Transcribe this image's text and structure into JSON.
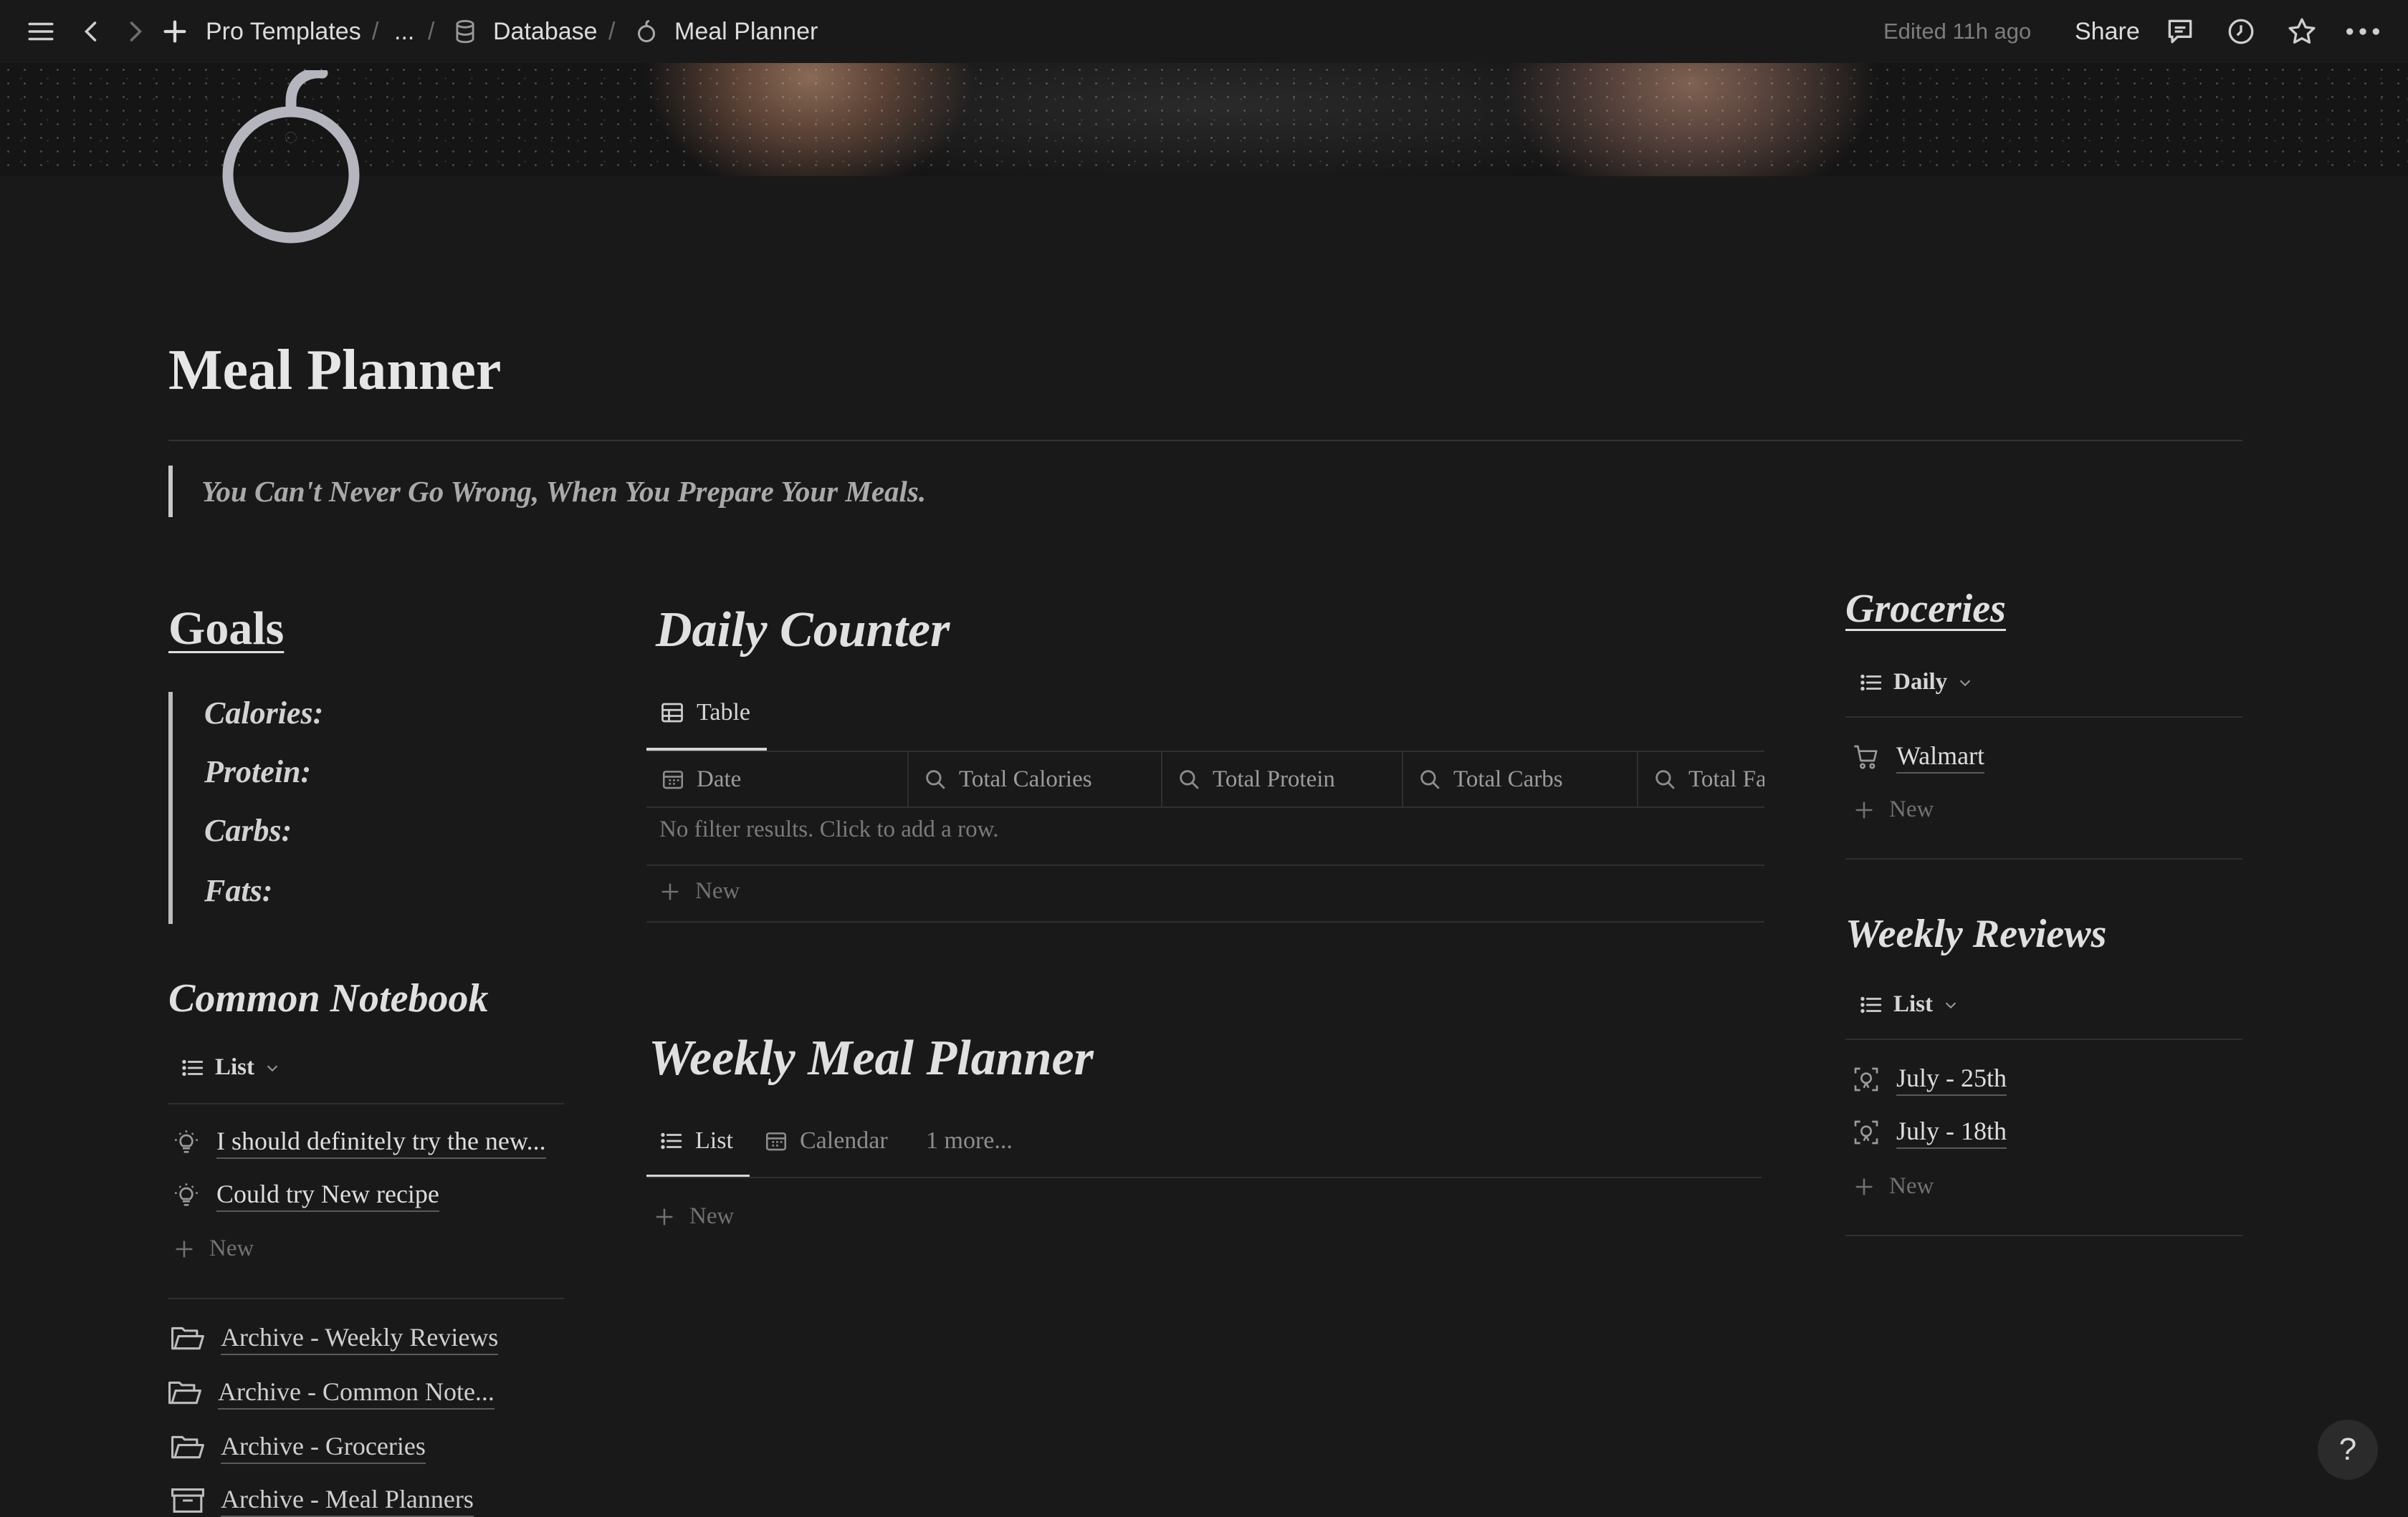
{
  "topbar": {
    "breadcrumbs": [
      "Pro Templates",
      "...",
      "Database",
      "Meal Planner"
    ],
    "edited": "Edited 11h ago",
    "share_label": "Share"
  },
  "page": {
    "title": "Meal Planner",
    "quote": "You Can't Never Go Wrong, When You Prepare Your Meals."
  },
  "goals": {
    "heading": "Goals",
    "items": [
      "Calories:",
      "Protein:",
      "Carbs:",
      "Fats:"
    ]
  },
  "common_notebook": {
    "heading": "Common Notebook",
    "view": "List",
    "items": [
      "I should definitely try the new...",
      "Could try New recipe"
    ],
    "new_label": "New"
  },
  "archives": [
    "Archive - Weekly Reviews",
    "Archive - Common Note...",
    "Archive - Groceries",
    "Archive - Meal Planners"
  ],
  "daily_counter": {
    "heading": "Daily Counter",
    "tab": "Table",
    "columns": [
      "Date",
      "Total Calories",
      "Total Protein",
      "Total Carbs",
      "Total Fats"
    ],
    "empty_message": "No filter results. Click to add a row.",
    "new_label": "New"
  },
  "weekly_meal_planner": {
    "heading": "Weekly Meal Planner",
    "tabs": [
      "List",
      "Calendar",
      "1 more..."
    ],
    "new_label": "New"
  },
  "groceries": {
    "heading": "Groceries",
    "view": "Daily",
    "items": [
      "Walmart"
    ],
    "new_label": "New"
  },
  "weekly_reviews": {
    "heading": "Weekly Reviews",
    "view": "List",
    "items": [
      "July - 25th",
      "July - 18th"
    ],
    "new_label": "New"
  },
  "help_label": "?"
}
